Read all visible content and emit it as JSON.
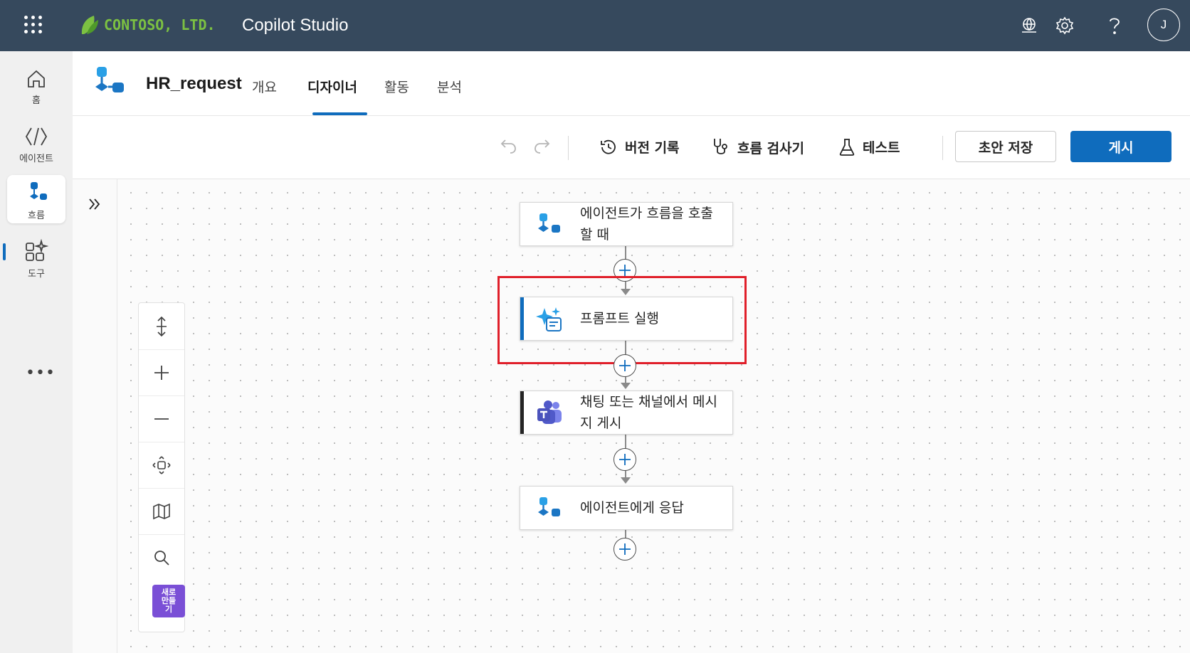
{
  "app": {
    "company": "CONTOSO, LTD.",
    "title": "Copilot Studio",
    "avatar_initial": "J",
    "icons": [
      "waffle-icon",
      "environment-icon",
      "gear-icon",
      "help-icon"
    ]
  },
  "rail": {
    "items": [
      {
        "label": "홈",
        "icon": "home-icon"
      },
      {
        "label": "에이전트",
        "icon": "agent-icon"
      },
      {
        "label": "흐름",
        "icon": "flow-icon",
        "active": true
      },
      {
        "label": "도구",
        "icon": "tools-icon"
      }
    ],
    "more": "•••"
  },
  "header": {
    "flow_name": "HR_request",
    "tabs": [
      "개요",
      "디자이너",
      "활동",
      "분석"
    ],
    "active_tab": "디자이너"
  },
  "toolbar": {
    "version_history": "버전 기록",
    "flow_checker": "흐름 검사기",
    "test": "테스트",
    "save_draft": "초안 저장",
    "publish": "게시"
  },
  "canvas": {
    "nodes": [
      {
        "text": "에이전트가 흐름을 호출할 때",
        "icon": "flow-trigger-icon"
      },
      {
        "text": "프롬프트 실행",
        "icon": "prompt-sparkle-icon",
        "highlighted": true
      },
      {
        "text": "채팅 또는 채널에서 메시지 게시",
        "icon": "teams-icon"
      },
      {
        "text": "에이전트에게 응답",
        "icon": "flow-respond-icon"
      }
    ],
    "new_badge": "새로\n만들\n기"
  },
  "colors": {
    "topbar": "#36495d",
    "brand_green": "#7cc142",
    "accent": "#0f6cbd",
    "highlight": "#e01f2a",
    "badge_purple": "#7a4fd6"
  }
}
